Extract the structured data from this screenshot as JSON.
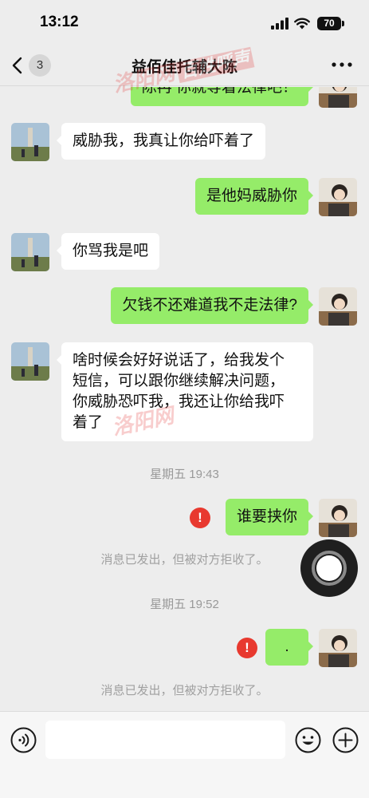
{
  "status_bar": {
    "time": "13:12",
    "battery": "70"
  },
  "header": {
    "back_count": "3",
    "title": "益佰佳托辅大陈"
  },
  "messages": [
    {
      "text": "陈冉 你就等着法律吧！"
    },
    {
      "text": "威胁我，我真让你给吓着了"
    },
    {
      "text": "是他妈威胁你"
    },
    {
      "text": "你骂我是吧"
    },
    {
      "text": "欠钱不还难道我不走法律?"
    },
    {
      "lines": [
        "啥时候会好好说话了，给我发个",
        "短信，可以跟你继续解决问题，",
        "你威胁恐吓我，我还让你给我吓",
        "着了"
      ]
    },
    {
      "text": "谁要挟你"
    },
    {
      "text": "."
    }
  ],
  "timestamps": [
    "星期五 19:43",
    "星期五 19:52"
  ],
  "system_notes": [
    "消息已发出，但被对方拒收了。",
    "消息已发出，但被对方拒收了。"
  ],
  "error_mark": "!",
  "watermark": {
    "site": "洛阳网",
    "column": "百姓呼声"
  },
  "colors": {
    "outgoing_bubble": "#95ec69",
    "incoming_bubble": "#ffffff",
    "error_red": "#e8392f",
    "background": "#ededed"
  },
  "icons": {
    "back": "chevron-left-icon",
    "more": "more-dots-icon",
    "voice": "voice-icon",
    "emoji": "emoji-icon",
    "plus": "plus-icon",
    "error": "error-icon"
  }
}
